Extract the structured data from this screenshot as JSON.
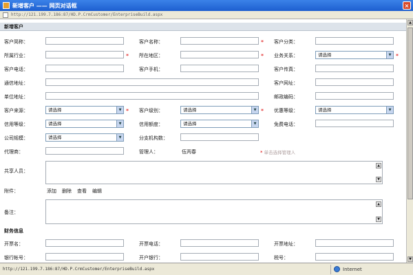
{
  "window": {
    "title": "新增客户 —— 网页对话框",
    "close": "×"
  },
  "address": "http://121.199.7.186:87/HD.P.CrmCustomer/EnterpriseBuild.aspx",
  "section_title": "新增客户",
  "labels": {
    "short_name": "客户简称：",
    "cust_name": "客户名称：",
    "cust_type": "客户分类：",
    "industry": "所属行业：",
    "region": "所在地区：",
    "relation": "业务关系：",
    "phone": "客户电话：",
    "mobile": "客户手机：",
    "fax": "客户传真：",
    "mail_addr": "通信地址：",
    "website": "客户网址：",
    "company_addr": "单位地址：",
    "postcode": "邮政编码：",
    "source": "客户来源：",
    "level": "客户级别：",
    "discount": "优惠等级：",
    "credit_level": "信用等级：",
    "credit_limit": "信用额度：",
    "free_call": "免费电话：",
    "scale": "公司规模：",
    "branches": "分支机构数：",
    "agent": "代理商：",
    "manager": "管理人：",
    "sharers": "共享人员：",
    "attachment": "附件：",
    "remarks": "备注：",
    "finance": "财务信息",
    "invoice_name": "开票名：",
    "invoice_phone": "开票电话：",
    "invoice_addr": "开票地址：",
    "bank_account": "银行帐号：",
    "bank": "开户银行：",
    "tax_no": "税号："
  },
  "select_placeholder": "请选择",
  "manager_value": "伍丙春",
  "manager_hint": "单击选择管理人",
  "attachment_actions": {
    "add": "添加",
    "delete": "删除",
    "view": "查看",
    "edit": "编辑"
  },
  "status": {
    "url": "http://121.199.7.186:87/HD.P.CrmCustomer/EnterpriseBuild.aspx",
    "zone": "Internet"
  },
  "scroll": {
    "up": "▲",
    "down": "▼"
  },
  "accent": "#1d5fd0",
  "required_color": "#dd0000"
}
